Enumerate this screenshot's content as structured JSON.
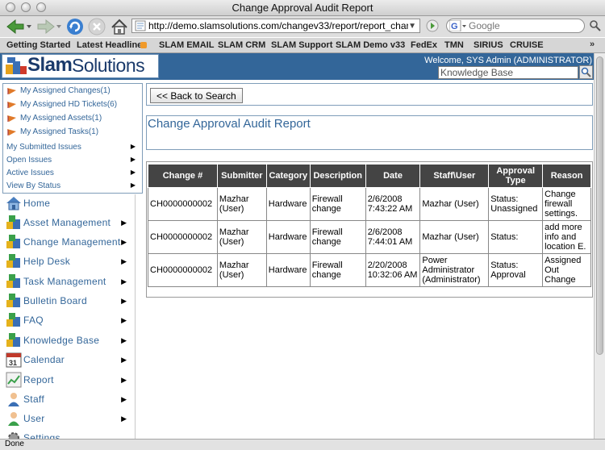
{
  "window": {
    "title": "Change Approval Audit Report"
  },
  "browser": {
    "url": "http://demo.slamsolutions.com/changev33/report/report_chang",
    "search_placeholder": "Google",
    "status": "Done"
  },
  "bookmarks": [
    "Getting Started",
    "Latest Headlines",
    "SLAM EMAIL",
    "SLAM CRM",
    "SLAM Support",
    "SLAM Demo v33",
    "FedEx",
    "TMN",
    "SIRIUS",
    "CRUISE"
  ],
  "header": {
    "logo_slam": "Slam",
    "logo_solutions": "Solutions",
    "welcome": "Welcome, SYS Admin (ADMINISTRATOR)",
    "kb_search_value": "Knowledge Base"
  },
  "quick_links": [
    "My Assigned Changes(1)",
    "My Assigned HD Tickets(6)",
    "My Assigned Assets(1)",
    "My Assigned Tasks(1)"
  ],
  "quick_menus": [
    "My Submitted Issues",
    "Open Issues",
    "Active Issues",
    "View By Status"
  ],
  "menu": [
    {
      "label": "Home",
      "icon": "home-icon",
      "arrow": false
    },
    {
      "label": "Asset Management",
      "icon": "cubes-icon",
      "arrow": true
    },
    {
      "label": "Change Management",
      "icon": "cubes-icon",
      "arrow": true
    },
    {
      "label": "Help Desk",
      "icon": "cubes-icon",
      "arrow": true
    },
    {
      "label": "Task Management",
      "icon": "cubes-icon",
      "arrow": true
    },
    {
      "label": "Bulletin Board",
      "icon": "cubes-icon",
      "arrow": true
    },
    {
      "label": "FAQ",
      "icon": "cubes-icon",
      "arrow": true
    },
    {
      "label": "Knowledge Base",
      "icon": "cubes-icon",
      "arrow": true
    },
    {
      "label": "Calendar",
      "icon": "calendar-icon",
      "arrow": true
    },
    {
      "label": "Report",
      "icon": "report-icon",
      "arrow": true
    },
    {
      "label": "Staff",
      "icon": "person-icon",
      "arrow": true
    },
    {
      "label": "User",
      "icon": "person-icon",
      "arrow": true
    },
    {
      "label": "Settings",
      "icon": "gear-icon",
      "arrow": false
    }
  ],
  "calendar_day": "31",
  "main": {
    "back_label": "<< Back to Search",
    "report_title": "Change Approval Audit Report",
    "columns": [
      "Change #",
      "Submitter",
      "Category",
      "Description",
      "Date",
      "Staff\\User",
      "Approval Type",
      "Reason"
    ],
    "rows": [
      [
        "CH0000000002",
        "Mazhar (User)",
        "Hardware",
        "Firewall change",
        "2/6/2008 7:43:22 AM",
        "Mazhar (User)",
        "Status: Unassigned",
        "Change firewall settings."
      ],
      [
        "CH0000000002",
        "Mazhar (User)",
        "Hardware",
        "Firewall change",
        "2/6/2008 7:44:01 AM",
        "Mazhar (User)",
        "Status:",
        "add more info and location E."
      ],
      [
        "CH0000000002",
        "Mazhar (User)",
        "Hardware",
        "Firewall change",
        "2/20/2008 10:32:06 AM",
        "Power Administrator (Administrator)",
        "Status: Approval",
        "Assigned Out Change"
      ]
    ]
  },
  "colors": {
    "brand": "#336699",
    "table_header": "#444444",
    "link": "#336699"
  }
}
